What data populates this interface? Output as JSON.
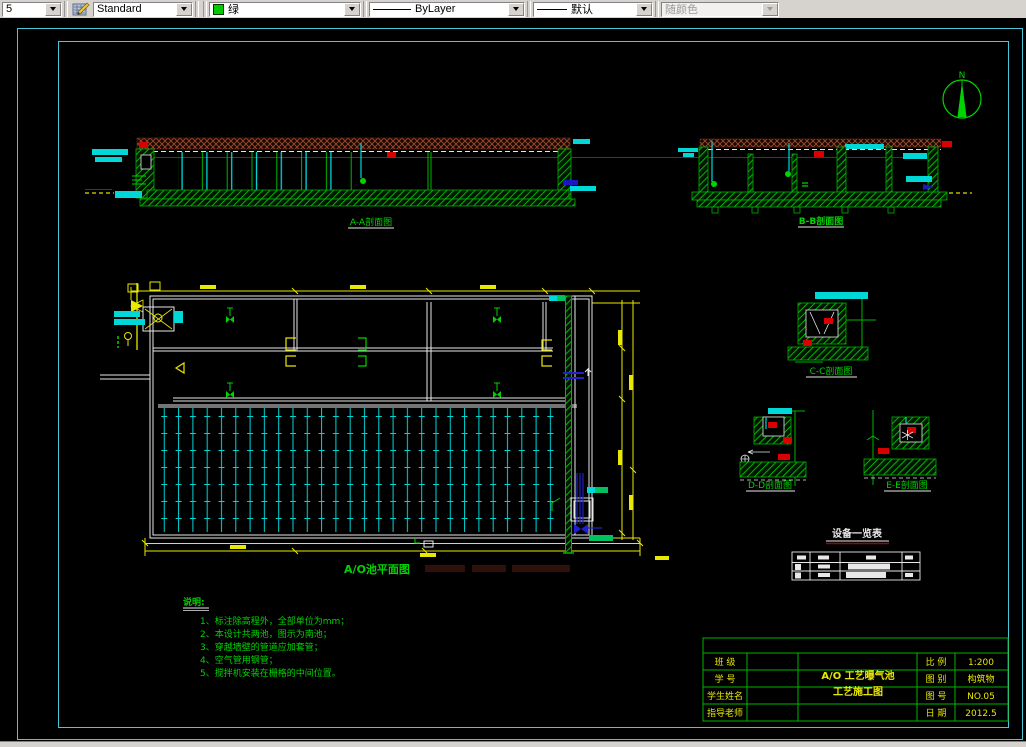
{
  "toolbar": {
    "zoom_combo": {
      "value": "5"
    },
    "style_combo": {
      "value": "Standard"
    },
    "color_combo": {
      "value": "绿",
      "swatch_color": "#00cc00"
    },
    "linetype_combo": {
      "value": "ByLayer"
    },
    "lineweight_combo": {
      "value": "默认"
    },
    "plotstyle_combo": {
      "value": "随颜色",
      "enabled": false
    }
  },
  "drawing": {
    "north_arrow": {
      "label": "N"
    },
    "section_labels": {
      "aa": "A-A剖面图",
      "bb": "B-B剖面图",
      "cc": "C-C剖面图",
      "dd": "D-D剖面图",
      "ee": "E-E剖面图"
    },
    "plan_label": "A/O池平面图",
    "equipment_table": {
      "title": "设备一览表"
    },
    "notes": {
      "title": "说明:",
      "items": [
        "1、标注除高程外，全部单位为mm；",
        "2、本设计共两池，图示为南池；",
        "3、穿越墙壁的管道应加套管；",
        "4、空气管用钢管；",
        "5、搅拌机安装在栅格的中间位置。"
      ]
    },
    "title_block": {
      "left_rows": [
        {
          "label": "班 级",
          "value": ""
        },
        {
          "label": "学 号",
          "value": ""
        },
        {
          "label": "学生姓名",
          "value": ""
        },
        {
          "label": "指导老师",
          "value": ""
        }
      ],
      "project_line1": "A/O 工艺曝气池",
      "project_line2": "工艺施工图",
      "right_rows": [
        {
          "label": "比 例",
          "value": "1:200"
        },
        {
          "label": "图 别",
          "value": "构筑物"
        },
        {
          "label": "图 号",
          "value": "NO.05"
        },
        {
          "label": "日 期",
          "value": "2012.5"
        }
      ]
    },
    "colors": {
      "line_green": "#00d400",
      "line_cyan": "#00d8d8",
      "line_yellow": "#e8e800",
      "line_red": "#d80000",
      "line_white": "#e8e8e8",
      "line_blue": "#2020d0",
      "roof_hatch_brown": "#96462a",
      "frame_cyan": "#48c8d8",
      "titleblock_green": "#00b400"
    }
  }
}
